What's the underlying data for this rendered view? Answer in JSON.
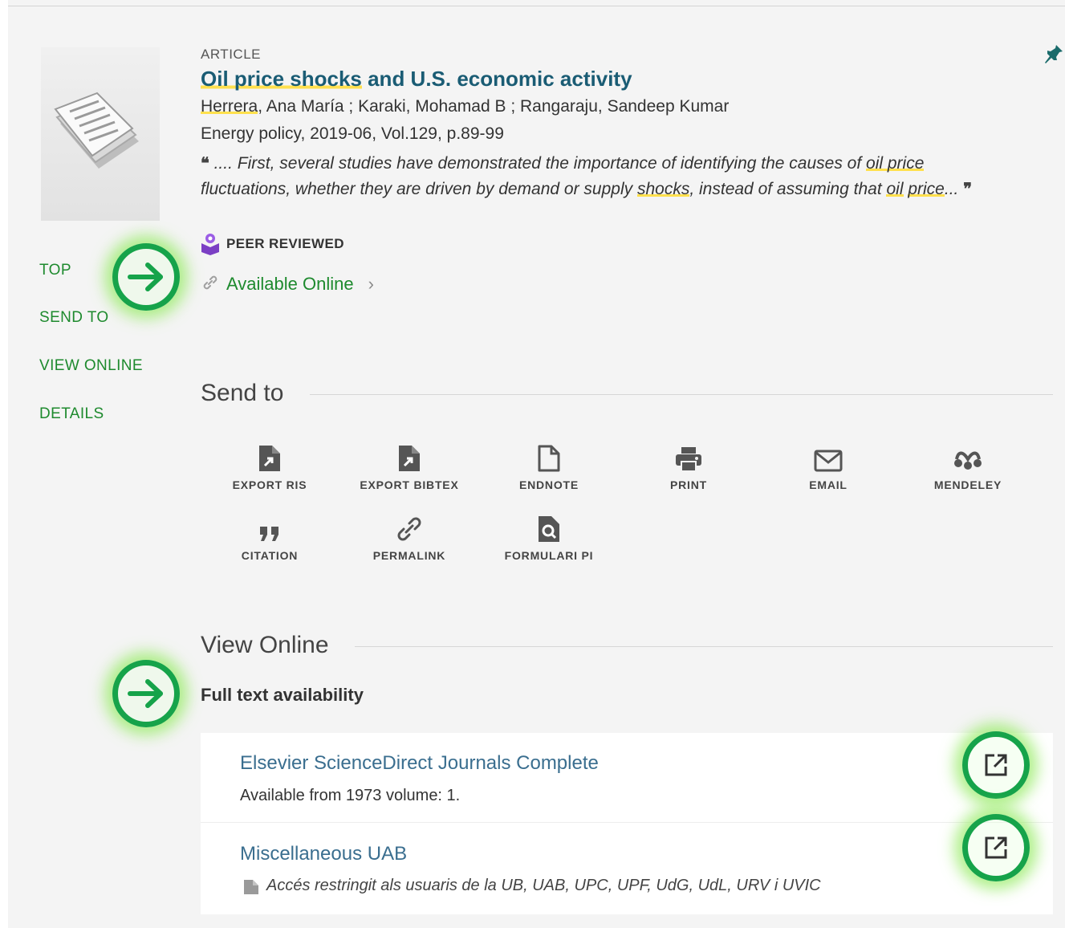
{
  "record": {
    "type_label": "ARTICLE",
    "title_part1": "Oil price shocks",
    "title_part2": " and U.S. economic activity",
    "author1": "Herrera",
    "authors_rest": ", Ana María ; Karaki, Mohamad B ; Rangaraju, Sandeep Kumar",
    "source": "Energy policy, 2019-06, Vol.129, p.89-99",
    "snippet": {
      "open_quote": "❝",
      "part1": " .... First, several studies have demonstrated the importance of identifying the causes of ",
      "hl1": "oil price",
      "part2": " fluctuations, whether they are driven by demand or supply ",
      "hl2": "shocks",
      "part3": ", instead of assuming that ",
      "hl3": "oil",
      "part4": " ",
      "hl4": "price",
      "part5": "...",
      "close_quote": "❞"
    },
    "peer_reviewed": "PEER REVIEWED",
    "availability": "Available Online",
    "availability_chevron": "›"
  },
  "side_nav": {
    "top": "TOP",
    "send_to": "SEND TO",
    "view_online": "VIEW ONLINE",
    "details": "DETAILS"
  },
  "send_to": {
    "title": "Send to",
    "actions": [
      {
        "label": "EXPORT RIS",
        "icon": "export-file-icon"
      },
      {
        "label": "EXPORT BIBTEX",
        "icon": "export-file-icon"
      },
      {
        "label": "ENDNOTE",
        "icon": "document-outline-icon"
      },
      {
        "label": "PRINT",
        "icon": "printer-icon"
      },
      {
        "label": "EMAIL",
        "icon": "envelope-icon"
      },
      {
        "label": "MENDELEY",
        "icon": "mendeley-icon"
      },
      {
        "label": "CITATION",
        "icon": "quote-icon"
      },
      {
        "label": "PERMALINK",
        "icon": "link-icon"
      },
      {
        "label": "FORMULARI PI",
        "icon": "document-search-icon"
      }
    ]
  },
  "view_online": {
    "title": "View Online",
    "full_text_label": "Full text availability",
    "services": [
      {
        "name": "Elsevier ScienceDirect Journals Complete",
        "note": "Available from 1973 volume: 1."
      },
      {
        "name": "Miscellaneous UAB",
        "note": "Accés restringit als usuaris de la UB, UAB, UPC, UPF, UdG, UdL, URV i UVIC"
      }
    ]
  },
  "colors": {
    "accent_green": "#1e8a2e",
    "title_blue": "#1a5c74",
    "highlight_yellow": "#ffe04d",
    "callout_green": "#16a34a"
  }
}
